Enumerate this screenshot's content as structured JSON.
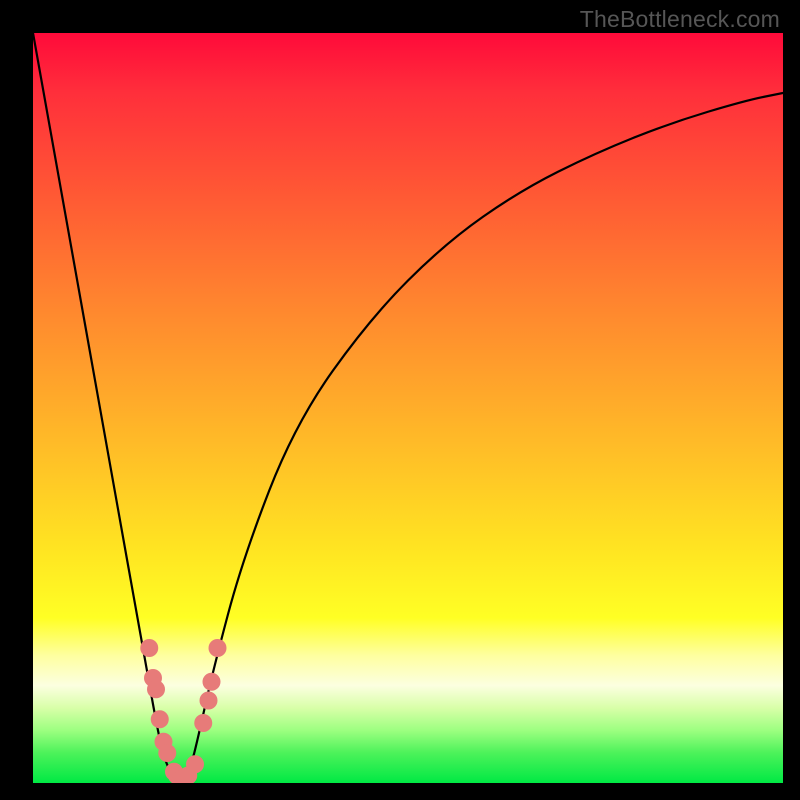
{
  "watermark": "TheBottleneck.com",
  "chart_data": {
    "type": "line",
    "title": "",
    "xlabel": "",
    "ylabel": "",
    "ylim": [
      0,
      100
    ],
    "x": [
      0,
      5,
      10,
      15,
      17,
      18,
      19,
      20,
      21,
      22,
      24,
      28,
      35,
      45,
      55,
      65,
      75,
      85,
      95,
      100
    ],
    "series": [
      {
        "name": "bottleneck-curve",
        "values": [
          100,
          72,
          44,
          16,
          5,
          2,
          0.5,
          0,
          2,
          6,
          15,
          30,
          48,
          62,
          72,
          79,
          84,
          88,
          91,
          92
        ]
      }
    ],
    "markers": {
      "name": "marker-dots",
      "color": "#e77b79",
      "points": [
        {
          "x": 15.5,
          "y": 18.0
        },
        {
          "x": 16.0,
          "y": 14.0
        },
        {
          "x": 16.4,
          "y": 12.5
        },
        {
          "x": 16.9,
          "y": 8.5
        },
        {
          "x": 17.4,
          "y": 5.5
        },
        {
          "x": 17.9,
          "y": 4.0
        },
        {
          "x": 18.8,
          "y": 1.5
        },
        {
          "x": 19.2,
          "y": 1.0
        },
        {
          "x": 19.8,
          "y": 0.5
        },
        {
          "x": 20.7,
          "y": 1.0
        },
        {
          "x": 21.6,
          "y": 2.5
        },
        {
          "x": 22.7,
          "y": 8.0
        },
        {
          "x": 23.4,
          "y": 11.0
        },
        {
          "x": 23.8,
          "y": 13.5
        },
        {
          "x": 24.6,
          "y": 18.0
        }
      ]
    }
  }
}
